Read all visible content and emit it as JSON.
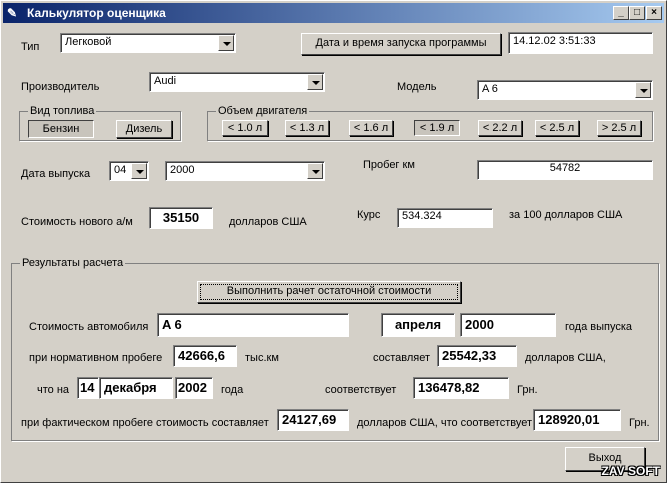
{
  "window": {
    "title": "Калькулятор оценщика",
    "min": "_",
    "max": "□",
    "close": "×"
  },
  "type": {
    "label": "Тип",
    "value": "Легковой"
  },
  "launch": {
    "button": "Дата и время запуска программы",
    "value": "14.12.02 3:51:33"
  },
  "manufacturer": {
    "label": "Производитель",
    "value": "Audi"
  },
  "model": {
    "label": "Модель",
    "value": "A 6"
  },
  "fuel": {
    "title": "Вид топлива",
    "options": [
      "Бензин",
      "Дизель"
    ],
    "selected": "Бензин"
  },
  "engine": {
    "title": "Объем двигателя",
    "options": [
      "< 1.0 л",
      "< 1.3 л",
      "< 1.6 л",
      "< 1.9 л",
      "< 2.2 л",
      "< 2.5 л",
      "> 2.5 л"
    ],
    "selected": "< 1.9 л"
  },
  "release": {
    "label": "Дата выпуска",
    "month": "04",
    "year": "2000"
  },
  "mileage": {
    "label": "Пробег км",
    "value": "54782"
  },
  "new_cost": {
    "label": "Стоимость нового а/м",
    "value": "35150",
    "unit": "долларов США"
  },
  "rate": {
    "label": "Курс",
    "value": "534.324",
    "unit": "за 100 долларов США"
  },
  "results": {
    "title": "Результаты расчета",
    "calc_button": "Выполнить рачет остаточной стоимости",
    "car_cost_label": "Стоимость автомобиля",
    "car_name": "A 6",
    "month_word": "апреля",
    "year": "2000",
    "year_suffix": "года выпуска",
    "norm_label": "при нормативном пробеге",
    "norm_value": "42666,6",
    "norm_unit": "тыс.км",
    "amounts_label": "составляет",
    "usd_value": "25542,33",
    "usd_unit": "долларов США,",
    "on_label": "что на",
    "day": "14",
    "month": "декабря",
    "cur_year": "2002",
    "year_word": "года",
    "equiv_label": "соответствует",
    "uah_value": "136478,82",
    "uah_unit": "Грн.",
    "actual_label": "при фактическом пробеге стоимость составляет",
    "actual_usd": "24127,69",
    "actual_mid": "долларов США, что соответствует",
    "actual_uah": "128920,01",
    "actual_unit": "Грн."
  },
  "exit_button": "Выход",
  "watermark": "ZAV SOFT"
}
